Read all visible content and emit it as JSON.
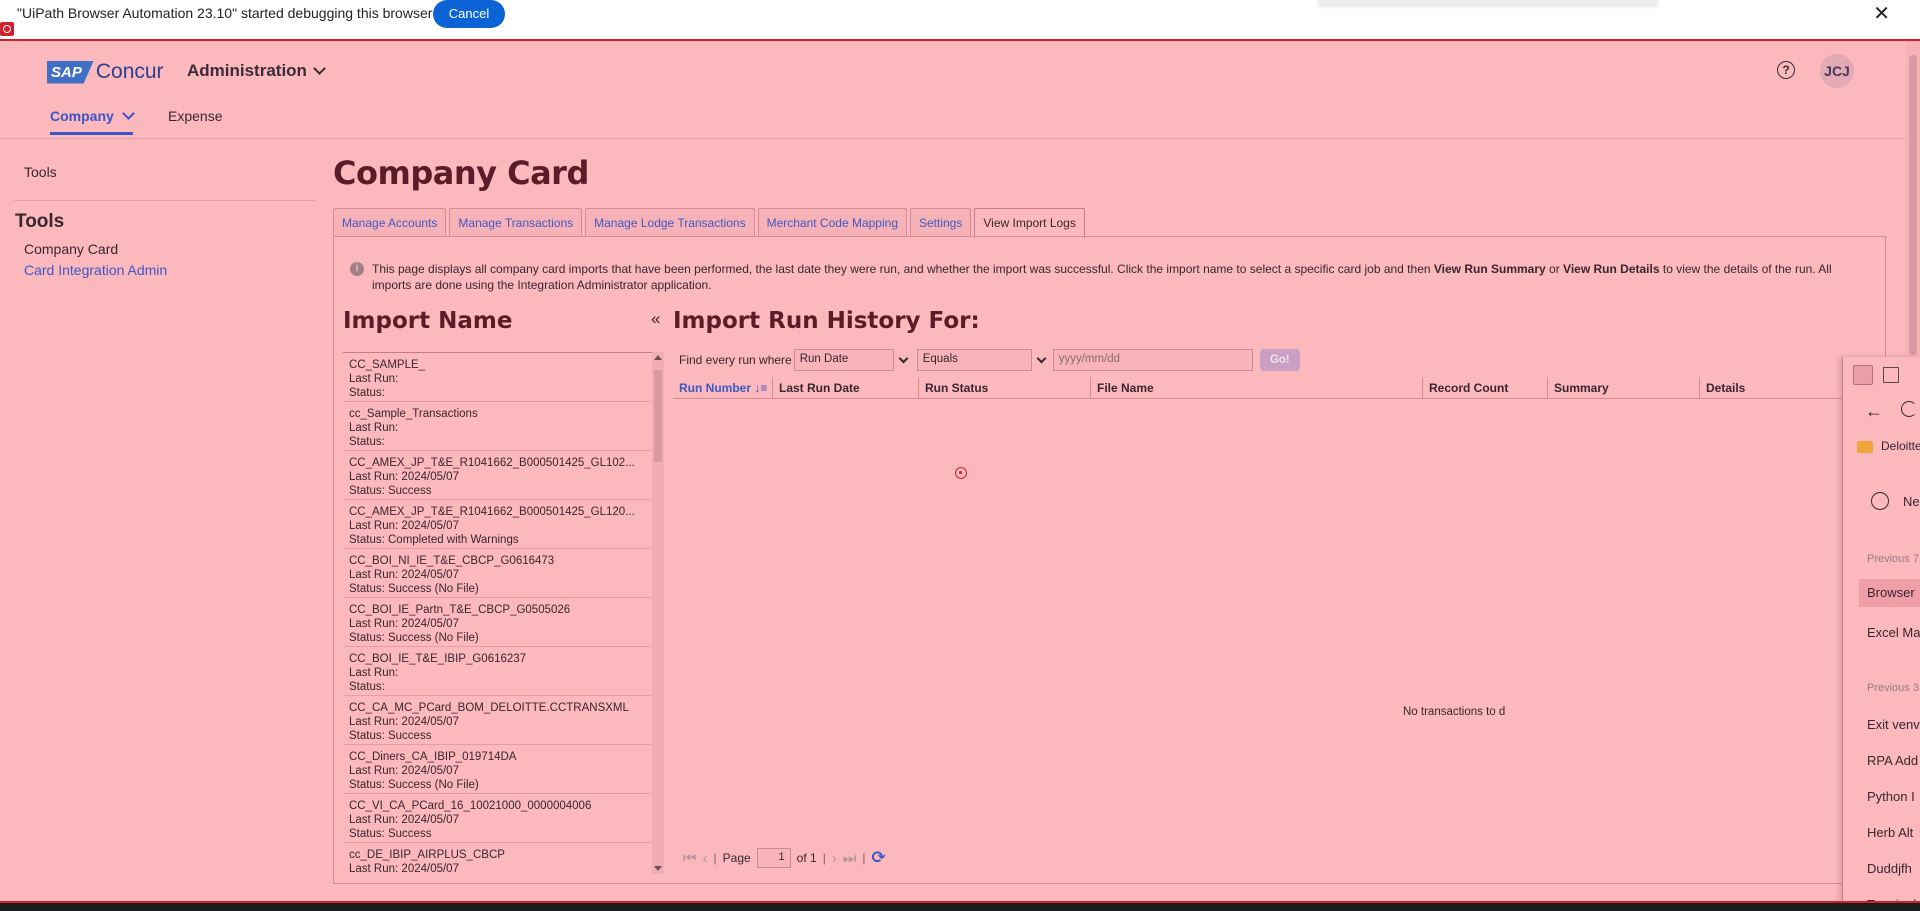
{
  "debug_bar": {
    "message": "\"UiPath Browser Automation 23.10\" started debugging this browser",
    "cancel_label": "Cancel",
    "close_glyph": "✕"
  },
  "header": {
    "logo_sap": "SAP",
    "logo_concur": "Concur",
    "admin_menu": "Administration",
    "help_glyph": "?",
    "avatar_initials": "JCJ",
    "nav": {
      "company": "Company",
      "expense": "Expense"
    }
  },
  "sidebar": {
    "tools_top": "Tools",
    "heading": "Tools",
    "items": [
      {
        "label": "Company Card"
      },
      {
        "label": "Card Integration Admin"
      }
    ]
  },
  "main": {
    "title": "Company Card",
    "tabs": [
      {
        "label": "Manage Accounts"
      },
      {
        "label": "Manage Transactions"
      },
      {
        "label": "Manage Lodge Transactions"
      },
      {
        "label": "Merchant Code Mapping"
      },
      {
        "label": "Settings"
      },
      {
        "label": "View Import Logs"
      }
    ],
    "info": {
      "part1": "This page displays all company card imports that have been performed, the last date they were run, and whether the import was successful. Click the import name to select a specific card job and then ",
      "bold1": "View Run Summary",
      "part2": " or ",
      "bold2": "View Run Details",
      "part3": " to view the details of the run. All imports are done using the Integration Administrator application."
    },
    "import_name_title": "Import Name",
    "collapse_glyph": "«",
    "imports": [
      {
        "name": "CC_SAMPLE_",
        "last_run": "Last Run:",
        "status": "Status:"
      },
      {
        "name": "cc_Sample_Transactions",
        "last_run": "Last Run:",
        "status": "Status:"
      },
      {
        "name": "CC_AMEX_JP_T&E_R1041662_B000501425_GL102...",
        "last_run": "Last Run: 2024/05/07",
        "status": "Status: Success"
      },
      {
        "name": "CC_AMEX_JP_T&E_R1041662_B000501425_GL120...",
        "last_run": "Last Run: 2024/05/07",
        "status": "Status: Completed with Warnings"
      },
      {
        "name": "CC_BOI_NI_IE_T&E_CBCP_G0616473",
        "last_run": "Last Run: 2024/05/07",
        "status": "Status: Success (No File)"
      },
      {
        "name": "CC_BOI_IE_Partn_T&E_CBCP_G0505026",
        "last_run": "Last Run: 2024/05/07",
        "status": "Status: Success (No File)"
      },
      {
        "name": "CC_BOI_IE_T&E_IBIP_G0616237",
        "last_run": "Last Run:",
        "status": "Status:"
      },
      {
        "name": "CC_CA_MC_PCard_BOM_DELOITTE.CCTRANSXML",
        "last_run": "Last Run: 2024/05/07",
        "status": "Status: Success"
      },
      {
        "name": "CC_Diners_CA_IBIP_019714DA",
        "last_run": "Last Run: 2024/05/07",
        "status": "Status: Success (No File)"
      },
      {
        "name": "CC_VI_CA_PCard_16_10021000_0000004006",
        "last_run": "Last Run: 2024/05/07",
        "status": "Status: Success"
      },
      {
        "name": "cc_DE_IBIP_AIRPLUS_CBCP",
        "last_run": "Last Run: 2024/05/07",
        "status": ""
      }
    ],
    "history_title": "Import Run History For:",
    "filter": {
      "label": "Find every run where",
      "field_value": "Run Date",
      "operator_value": "Equals",
      "date_placeholder": "yyyy/mm/dd",
      "go_label": "Go!"
    },
    "columns": [
      "Run Number",
      "Last Run Date",
      "Run Status",
      "File Name",
      "Record Count",
      "Summary",
      "Details"
    ],
    "pager": {
      "page_label": "Page",
      "page_value": "1",
      "of_label": "of 1",
      "no_transactions": "No transactions to d"
    }
  },
  "overlay": {
    "folder_label": "Deloitte",
    "new_label": "Ne",
    "section1": "Previous 7",
    "items1": [
      "Browser",
      "Excel Ma"
    ],
    "section2": "Previous 3",
    "items2": [
      "Exit venv",
      "RPA Add",
      "Python I",
      "Herb Alt",
      "Duddjfh",
      "Terminal"
    ]
  }
}
